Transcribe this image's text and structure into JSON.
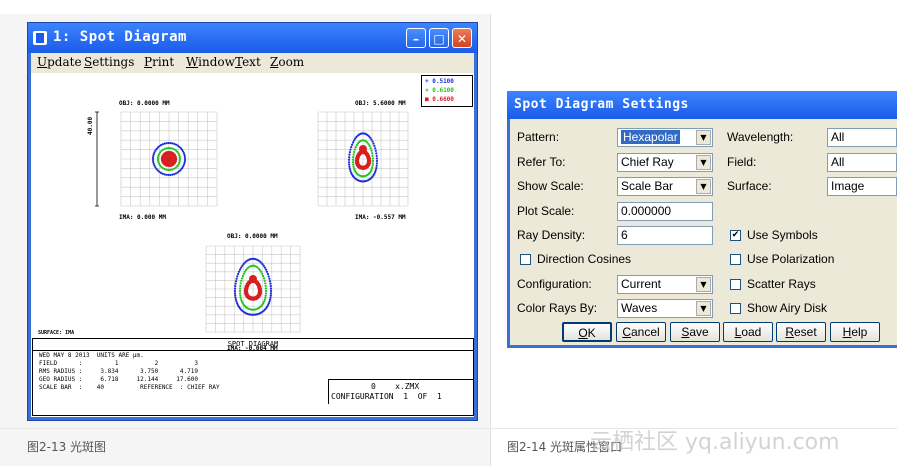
{
  "left_window": {
    "title": "1: Spot Diagram",
    "menu": [
      "Update",
      "Settings",
      "Print",
      "Window",
      "Text",
      "Zoom"
    ],
    "menu_first_letters": [
      "U",
      "S",
      "P",
      "W",
      "T",
      "Z"
    ],
    "obj_labels": [
      "OBJ: 0.0000 MM",
      "OBJ: 5.6000 MM",
      "OBJ: 0.0000 MM"
    ],
    "ima_labels": [
      "IMA: 0.000 MM",
      "IMA: -0.557 MM",
      "IMA: -0.004 MM"
    ],
    "scale_label": "40.00",
    "legend": [
      {
        "label": "0.5100",
        "color": "#1d2fd6"
      },
      {
        "label": "0.6100",
        "color": "#22c322"
      },
      {
        "label": "0.6600",
        "color": "#d81e1e"
      }
    ],
    "surface": "SURFACE: IMA",
    "panel_title": "SPOT DIAGRAM",
    "info": {
      "date_line": "WED MAY 8 2013  UNITS ARE µm.",
      "field_line": "FIELD      :         1          2          3",
      "rms_line": "RMS RADIUS :     3.834      3.750      4.719",
      "geo_line": "GEO RADIUS :     6.718     12.144     17.600",
      "scale_line": "SCALE BAR  :    40          REFERENCE  : CHIEF RAY",
      "file_line": "0    x.ZMX",
      "config_line": "CONFIGURATION  1  OF  1"
    }
  },
  "dialog": {
    "title": "Spot Diagram Settings",
    "pattern_label": "Pattern:",
    "pattern_value": "Hexapolar",
    "refer_label": "Refer To:",
    "refer_value": "Chief Ray",
    "scale_label": "Show Scale:",
    "scale_value": "Scale Bar",
    "plot_scale_label": "Plot Scale:",
    "plot_scale_value": "0.000000",
    "ray_density_label": "Ray Density:",
    "ray_density_value": "6",
    "direction_cosines": "Direction Cosines",
    "config_label": "Configuration:",
    "config_value": "Current",
    "color_rays_label": "Color Rays By:",
    "color_rays_value": "Waves",
    "wavelength_label": "Wavelength:",
    "wavelength_value": "All",
    "field_label": "Field:",
    "field_value": "All",
    "surface_label": "Surface:",
    "surface_value": "Image",
    "use_symbols": "Use Symbols",
    "use_polarization": "Use Polarization",
    "scatter_rays": "Scatter Rays",
    "show_airy": "Show Airy Disk",
    "buttons": {
      "ok_first": "O",
      "ok_rest": "K",
      "cancel_first": "C",
      "cancel_rest": "ancel",
      "save_first": "S",
      "save_rest": "ave",
      "load_first": "L",
      "load_rest": "oad",
      "reset_first": "R",
      "reset_rest": "eset",
      "help_first": "H",
      "help_rest": "elp"
    }
  },
  "captions": {
    "left": "图2-13 光斑图",
    "right": "图2-14 光斑属性窗口",
    "watermark": "云栖社区 yq.aliyun.com"
  }
}
